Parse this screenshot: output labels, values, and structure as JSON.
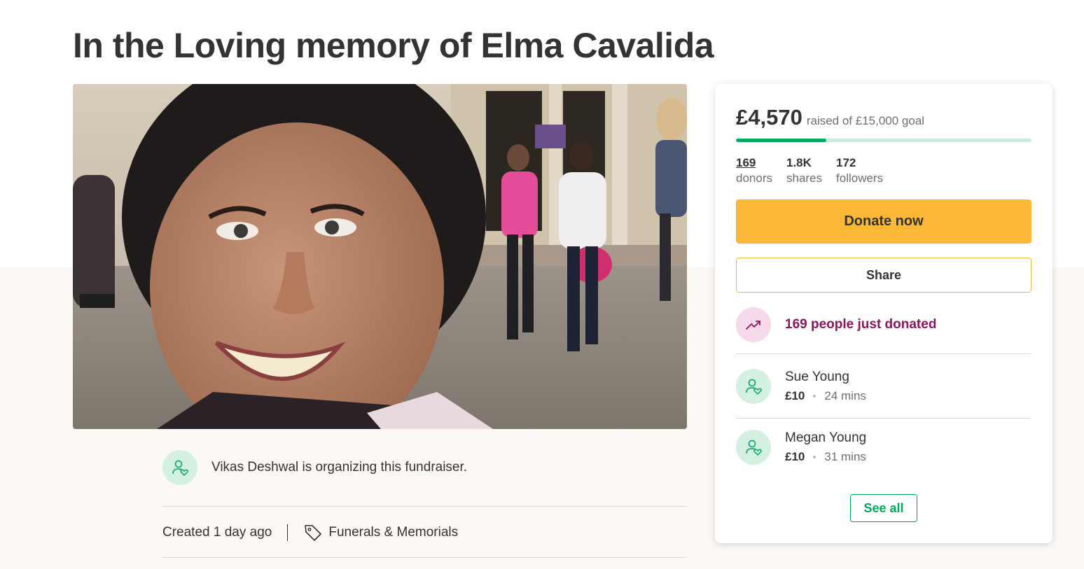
{
  "page": {
    "title": "In the Loving memory of Elma Cavalida"
  },
  "hero": {
    "icon": "person-photo",
    "alt": "Photo of a smiling woman on a city street"
  },
  "organizer": {
    "icon": "person-heart-icon",
    "text": "Vikas Deshwal is organizing this fundraiser."
  },
  "meta": {
    "created": "Created 1 day ago",
    "category_icon": "tag-icon",
    "category": "Funerals & Memorials"
  },
  "donation_card": {
    "raised_amount": "£4,570",
    "goal_text": "raised of £15,000 goal",
    "progress_fraction": 0.305,
    "stats": [
      {
        "value": "169",
        "label": "donors"
      },
      {
        "value": "1.8K",
        "label": "shares"
      },
      {
        "value": "172",
        "label": "followers"
      }
    ],
    "donate_label": "Donate now",
    "share_label": "Share",
    "trend_icon": "trending-up-icon",
    "trend_text": "169 people just donated",
    "donors": [
      {
        "name": "Sue Young",
        "amount": "£10",
        "time": "24 mins"
      },
      {
        "name": "Megan Young",
        "amount": "£10",
        "time": "31 mins"
      }
    ],
    "see_all_label": "See all"
  },
  "colors": {
    "brand_green": "#02a95c",
    "donate_yellow": "#fbb836",
    "trend_purple": "#90135f",
    "text": "#333333",
    "muted": "#6f6f6f",
    "page_bg_lower": "#fbf8f6"
  }
}
